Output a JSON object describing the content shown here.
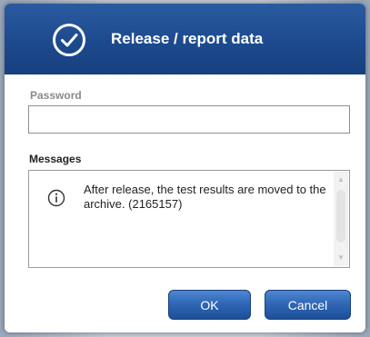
{
  "dialog": {
    "title": "Release / report data",
    "title_icon": "check-circle-icon"
  },
  "password": {
    "label": "Password",
    "value": "",
    "placeholder": ""
  },
  "messages": {
    "label": "Messages",
    "items": [
      {
        "icon": "info-icon",
        "text": "After release, the test results are moved to the archive. (2165157)"
      }
    ]
  },
  "buttons": {
    "ok_label": "OK",
    "cancel_label": "Cancel"
  },
  "colors": {
    "titlebar": "#1d4a8e",
    "button": "#2e65b3"
  }
}
